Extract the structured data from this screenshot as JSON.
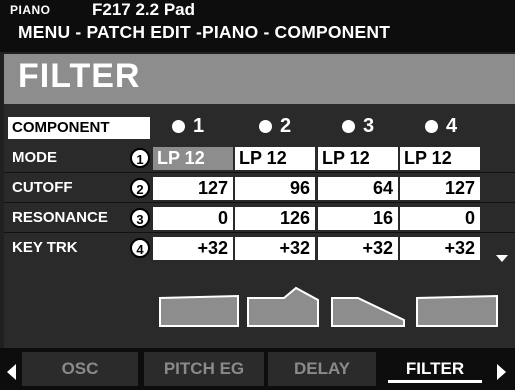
{
  "header": {
    "mode": "PIANO",
    "patch": "F217 2.2 Pad",
    "breadcrumb": "MENU - PATCH EDIT -PIANO  - COMPONENT",
    "page_title": "FILTER"
  },
  "table": {
    "component_label": "COMPONENT",
    "components": [
      "1",
      "2",
      "3",
      "4"
    ],
    "rows": [
      {
        "label": "MODE",
        "badge": "1",
        "values": [
          "LP 12",
          "LP 12",
          "LP 12",
          "LP 12"
        ],
        "selected_col": 0
      },
      {
        "label": "CUTOFF",
        "badge": "2",
        "values": [
          "127",
          "96",
          "64",
          "127"
        ]
      },
      {
        "label": "RESONANCE",
        "badge": "3",
        "values": [
          "0",
          "126",
          "16",
          "0"
        ]
      },
      {
        "label": "KEY TRK",
        "badge": "4",
        "values": [
          "+32",
          "+32",
          "+32",
          "+32"
        ]
      }
    ],
    "more_below_icon": "triangle-down-icon"
  },
  "filter_graphs": [
    {
      "shape": "flat"
    },
    {
      "shape": "resonant-peak"
    },
    {
      "shape": "lowpass-slope"
    },
    {
      "shape": "flat"
    }
  ],
  "tabs": {
    "items": [
      "OSC",
      "PITCH EG",
      "DELAY",
      "FILTER"
    ],
    "active": 3,
    "left_icon": "triangle-left-icon",
    "right_icon": "triangle-right-icon"
  },
  "colors": {
    "background": "#202020",
    "title_bar": "#8d8d8d",
    "cell": "#ffffff",
    "selected_cell": "#8d8d8d",
    "graph_fill": "#8d8d8d"
  }
}
